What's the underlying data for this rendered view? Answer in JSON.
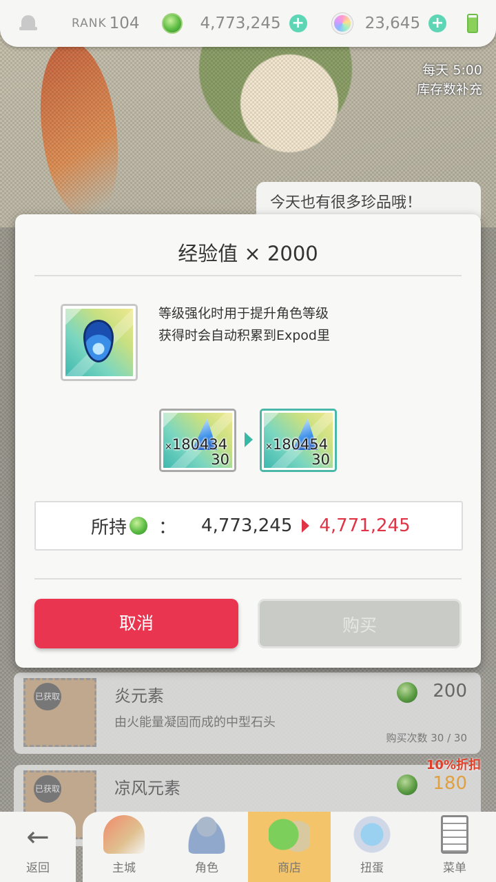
{
  "topbar": {
    "rank_label": "RANK",
    "rank_value": "104",
    "gems": "4,773,245",
    "orbs": "23,645",
    "plus_symbol": "+"
  },
  "banner": {
    "restock_time": "每天 5:00",
    "restock_label": "库存数补充",
    "shopkeeper_speech": "今天也有很多珍品哦！"
  },
  "store_list": [
    {
      "badge": "已获取",
      "name": "炎元素",
      "price": "200",
      "description": "由火能量凝固而成的中型石头",
      "purchase_count": "购买次数 30 / 30"
    },
    {
      "badge": "已获取",
      "name": "凉风元素",
      "price": "180",
      "sale_tag": "10%折扣"
    }
  ],
  "dialog": {
    "title": "经验值 × 2000",
    "description_line1": "等级强化时用于提升角色等级",
    "description_line2": "获得时会自动积累到Expod里",
    "before": {
      "count_prefix": "×",
      "count": "180434",
      "level": "30"
    },
    "after": {
      "count_prefix": "×",
      "count": "180454",
      "level": "30"
    },
    "balance_label": "所持",
    "balance_colon": "：",
    "balance_current": "4,773,245",
    "balance_after": "4,771,245",
    "cancel_label": "取消",
    "buy_label": "购买",
    "colors": {
      "cancel": "#e9354f",
      "after_value": "#e03446",
      "accent": "#3ab8a6"
    }
  },
  "nav": {
    "back": "返回",
    "items": [
      "主城",
      "角色",
      "商店",
      "扭蛋",
      "菜单"
    ],
    "active": "商店"
  }
}
